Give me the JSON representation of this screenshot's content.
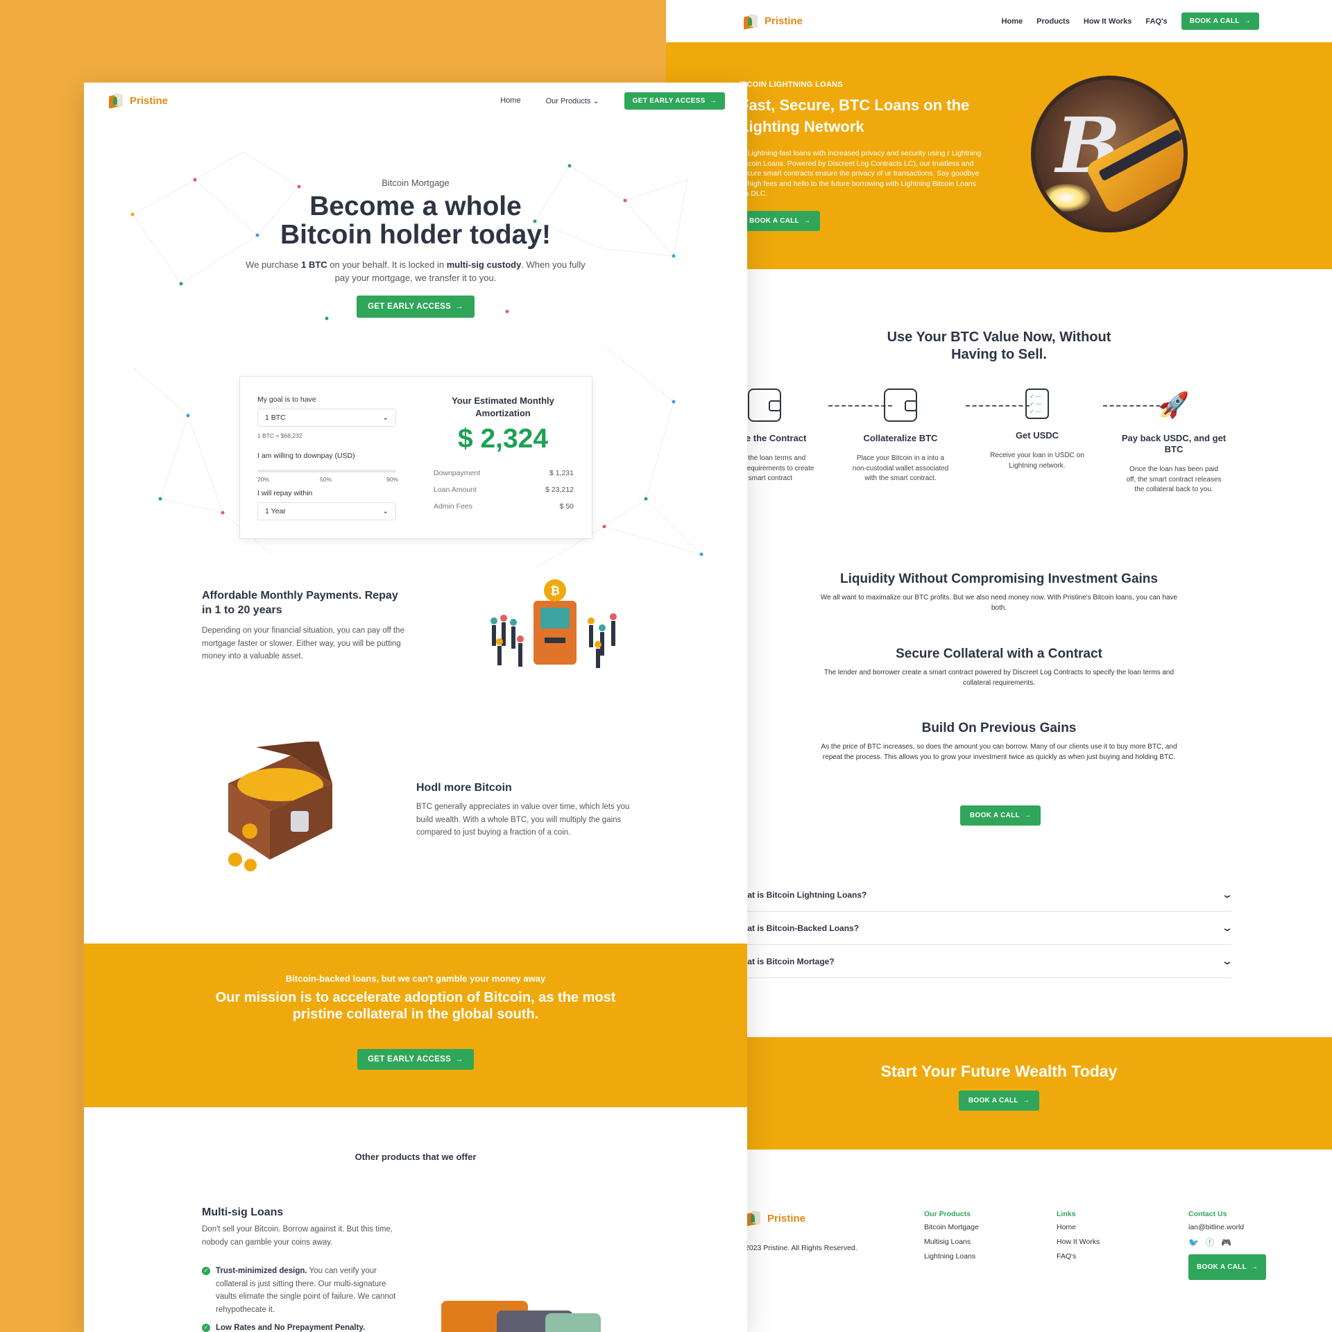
{
  "brand": {
    "name": "Pristine"
  },
  "right": {
    "nav": {
      "links": [
        "Home",
        "Products",
        "How It Works",
        "FAQ's"
      ],
      "cta": "BOOK A CALL"
    },
    "hero": {
      "eyebrow": "ITCOIN LIGHTNING LOANS",
      "title": "Fast, Secure, BTC Loans on the Lighting Network",
      "text": "et Lightning-fast loans with increased privacy and security using r Lightning Bitcoin Loans. Powered by Discreet Log Contracts LC), our trustless and secure smart contracts ensure the privacy of ur transactions. Say goodbye to high fees and hello to the future borrowing with Lightning Bitcoin Loans via DLC.",
      "cta": "BOOK A CALL"
    },
    "steps_title": "Use Your BTC Value Now, Without Having to Sell.",
    "steps": [
      {
        "icon": "wallet-icon",
        "title": "Create the Contract",
        "text": "Specify the loan terms and collateral requirements to create the smart contract"
      },
      {
        "icon": "wallet-icon",
        "title": "Collateralize BTC",
        "text": "Place your Bitcoin in a into a non-custodial wallet associated with the smart contract."
      },
      {
        "icon": "checklist-icon",
        "title": "Get USDC",
        "text": "Receive your loan in USDC on Lightning network."
      },
      {
        "icon": "rocket-icon",
        "title": "Pay back USDC, and get BTC",
        "text": "Once the loan has been paid off,  the smart contract releases the collateral back to you."
      }
    ],
    "features": [
      {
        "title": "Liquidity Without Compromising Investment Gains",
        "text": "We all want to maximalize our BTC profits. But we also need money now. With Pristine's Bitcoin loans, you can have both."
      },
      {
        "title": "Secure Collateral with a Contract",
        "text": "The lender and borrower create a smart contract powered by Discreet Log Contracts to specify the loan terms and collateral requirements."
      },
      {
        "title": "Build On Previous Gains",
        "text": "As the price of BTC increases, so does the amount you can borrow. Many of our clients use it to buy more BTC, and repeat the process. This allows you to grow your investment  twice as quickly as when just buying and holding BTC."
      }
    ],
    "features_cta": "BOOK A CALL",
    "faqs": [
      "hat is Bitcoin Lightning Loans?",
      "hat is Bitcoin-Backed Loans?",
      "hat is Bitcoin Mortage?"
    ],
    "cta": {
      "title": "Start Your Future Wealth Today",
      "button": "BOOK A CALL"
    },
    "footer": {
      "copyright": "2023 Pristine. All Rights Reserved.",
      "products": {
        "heading": "Our Products",
        "items": [
          "Bitcoin Mortgage",
          "Multisig Loans",
          "Lightning Loans"
        ]
      },
      "links": {
        "heading": "Links",
        "items": [
          "Home",
          "How It Works",
          "FAQ's"
        ]
      },
      "contact": {
        "heading": "Contact Us",
        "email": "ian@bitline.world",
        "button": "BOOK A CALL"
      }
    }
  },
  "left": {
    "nav": {
      "home": "Home",
      "products": "Our Products",
      "cta": "GET EARLY ACCESS"
    },
    "hero": {
      "eyebrow": "Bitcoin Mortgage",
      "title_line1": "Become a whole",
      "title_line2": "Bitcoin holder today!",
      "text_pre": "We purchase ",
      "text_b1": "1 BTC",
      "text_mid": " on your behalf. It is locked in ",
      "text_b2": "multi-sig custody",
      "text_post": ". When you fully pay your mortgage, we transfer it to you.",
      "cta": "GET EARLY ACCESS"
    },
    "calculator": {
      "goal_label": "My goal is to have",
      "goal_value": "1 BTC",
      "rate": "1 BTC = $68,232",
      "downpay_label": "I am willing to downpay (USD)",
      "slider_ticks": [
        "20%",
        "50%",
        "90%"
      ],
      "repay_label": "I will repay within",
      "repay_value": "1 Year",
      "est_title": "Your Estimated Monthly Amortization",
      "amount": "$ 2,324",
      "rows": [
        {
          "label": "Downpayment",
          "value": "$ 1,231"
        },
        {
          "label": "Loan Amount",
          "value": "$ 23,212"
        },
        {
          "label": "Admin Fees",
          "value": "$ 50"
        }
      ]
    },
    "feature1": {
      "title": "Affordable Monthly Payments. Repay in 1 to 20 years",
      "text": "Depending on your financial situation, you can pay off the mortgage faster or slower. Either way, you will be putting money into a valuable asset."
    },
    "feature2": {
      "title": "Hodl more Bitcoin",
      "text": "BTC generally appreciates in value over time, which lets you build wealth. With a whole BTC, you will multiply the gains compared to just buying a fraction of a coin."
    },
    "mission": {
      "eyebrow": "Bitcoin-backed loans, but we can't gamble your money away",
      "title": "Our mission is to accelerate adoption of Bitcoin, as the most pristine collateral in the global south.",
      "cta": "GET EARLY ACCESS"
    },
    "other_title": "Other products that we offer",
    "multisig": {
      "title": "Multi-sig Loans",
      "subtitle": "Don't sell your Bitcoin. Borrow against it. But this time, nobody can gamble your coins away.",
      "points": [
        {
          "bold": "Trust-minimized design.",
          "text": " You can verify your collateral is just sitting there. Our multi-signature vaults elimate the single point of failure. We cannot rehypothecate it."
        },
        {
          "bold": "Low Rates and No Prepayment Penalty.",
          "text": ""
        }
      ]
    }
  },
  "colors": {
    "accent_green": "#2fa65a",
    "brand_orange": "#e08a17",
    "banner_yellow": "#f0a90c",
    "background": "#f0ac3e"
  }
}
